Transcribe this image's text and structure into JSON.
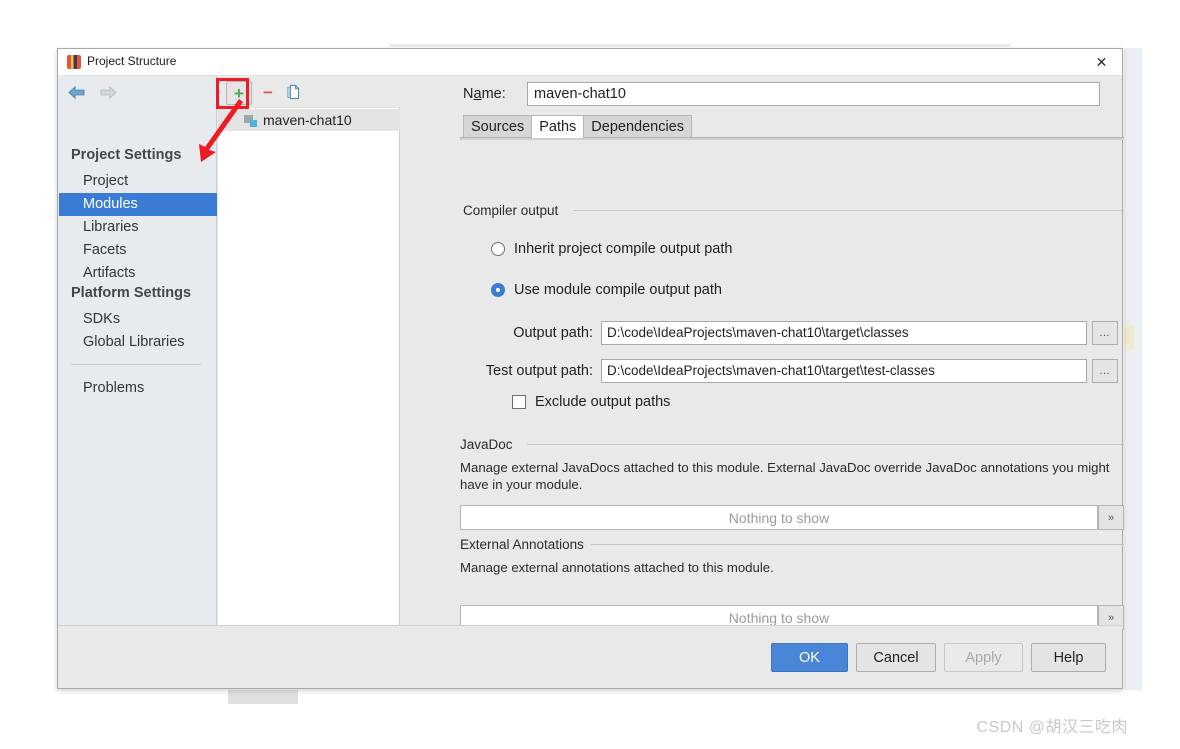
{
  "window": {
    "title": "Project Structure",
    "close_label": "✕"
  },
  "sidebar": {
    "back_icon": "back-arrow-icon",
    "forward_icon": "forward-arrow-icon",
    "groups": [
      {
        "heading": "Project Settings",
        "items": [
          "Project",
          "Modules",
          "Libraries",
          "Facets",
          "Artifacts"
        ]
      },
      {
        "heading": "Platform Settings",
        "items": [
          "SDKs",
          "Global Libraries"
        ]
      }
    ],
    "selected": "Modules",
    "extra_items": [
      "Problems"
    ]
  },
  "tree": {
    "toolbar": {
      "add_label": "+",
      "remove_label": "−",
      "copy_title": "copy-module"
    },
    "nodes": [
      {
        "label": "maven-chat10",
        "selected": true
      }
    ]
  },
  "module": {
    "name_label_pre": "N",
    "name_label_mnemonic": "a",
    "name_label_post": "me:",
    "name_value": "maven-chat10",
    "tabs": [
      {
        "label": "Sources",
        "active": false
      },
      {
        "label": "Paths",
        "active": true
      },
      {
        "label": "Dependencies",
        "active": false
      }
    ]
  },
  "compiler_output": {
    "group_title": "Compiler output",
    "options": [
      {
        "label": "Inherit project compile output path",
        "selected": false
      },
      {
        "label": "Use module compile output path",
        "selected": true
      }
    ],
    "fields": [
      {
        "label": "Output path:",
        "value": "D:\\code\\IdeaProjects\\maven-chat10\\target\\classes",
        "browse_label": "…"
      },
      {
        "label": "Test output path:",
        "value": "D:\\code\\IdeaProjects\\maven-chat10\\target\\test-classes",
        "browse_label": "…"
      }
    ],
    "exclude_checkbox": {
      "label": "Exclude output paths",
      "checked": false
    }
  },
  "javadoc": {
    "group_title": "JavaDoc",
    "description": "Manage external JavaDocs attached to this module. External JavaDoc override JavaDoc annotations you might have in your module.",
    "empty_text": "Nothing to show",
    "expand_label": "»"
  },
  "external_annotations": {
    "group_title": "External Annotations",
    "description": "Manage external annotations attached to this module.",
    "empty_text": "Nothing to show",
    "expand_label": "»"
  },
  "footer": {
    "buttons": [
      {
        "label": "OK",
        "style": "primary"
      },
      {
        "label": "Cancel",
        "style": "normal"
      },
      {
        "label": "Apply",
        "style": "disabled"
      },
      {
        "label": "Help",
        "style": "normal"
      }
    ]
  },
  "annotation": {
    "highlight_color": "#ee1b24",
    "target": "add-module-button"
  },
  "watermark": {
    "text": "CSDN @胡汉三吃肉"
  }
}
